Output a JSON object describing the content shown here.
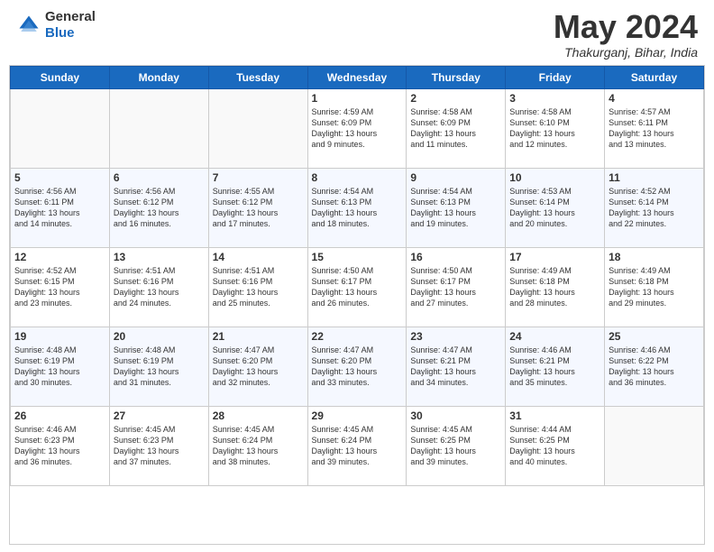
{
  "header": {
    "logo_line1": "General",
    "logo_line2": "Blue",
    "month_title": "May 2024",
    "location": "Thakurganj, Bihar, India"
  },
  "days_of_week": [
    "Sunday",
    "Monday",
    "Tuesday",
    "Wednesday",
    "Thursday",
    "Friday",
    "Saturday"
  ],
  "weeks": [
    [
      {
        "day": "",
        "info": ""
      },
      {
        "day": "",
        "info": ""
      },
      {
        "day": "",
        "info": ""
      },
      {
        "day": "1",
        "info": "Sunrise: 4:59 AM\nSunset: 6:09 PM\nDaylight: 13 hours\nand 9 minutes."
      },
      {
        "day": "2",
        "info": "Sunrise: 4:58 AM\nSunset: 6:09 PM\nDaylight: 13 hours\nand 11 minutes."
      },
      {
        "day": "3",
        "info": "Sunrise: 4:58 AM\nSunset: 6:10 PM\nDaylight: 13 hours\nand 12 minutes."
      },
      {
        "day": "4",
        "info": "Sunrise: 4:57 AM\nSunset: 6:11 PM\nDaylight: 13 hours\nand 13 minutes."
      }
    ],
    [
      {
        "day": "5",
        "info": "Sunrise: 4:56 AM\nSunset: 6:11 PM\nDaylight: 13 hours\nand 14 minutes."
      },
      {
        "day": "6",
        "info": "Sunrise: 4:56 AM\nSunset: 6:12 PM\nDaylight: 13 hours\nand 16 minutes."
      },
      {
        "day": "7",
        "info": "Sunrise: 4:55 AM\nSunset: 6:12 PM\nDaylight: 13 hours\nand 17 minutes."
      },
      {
        "day": "8",
        "info": "Sunrise: 4:54 AM\nSunset: 6:13 PM\nDaylight: 13 hours\nand 18 minutes."
      },
      {
        "day": "9",
        "info": "Sunrise: 4:54 AM\nSunset: 6:13 PM\nDaylight: 13 hours\nand 19 minutes."
      },
      {
        "day": "10",
        "info": "Sunrise: 4:53 AM\nSunset: 6:14 PM\nDaylight: 13 hours\nand 20 minutes."
      },
      {
        "day": "11",
        "info": "Sunrise: 4:52 AM\nSunset: 6:14 PM\nDaylight: 13 hours\nand 22 minutes."
      }
    ],
    [
      {
        "day": "12",
        "info": "Sunrise: 4:52 AM\nSunset: 6:15 PM\nDaylight: 13 hours\nand 23 minutes."
      },
      {
        "day": "13",
        "info": "Sunrise: 4:51 AM\nSunset: 6:16 PM\nDaylight: 13 hours\nand 24 minutes."
      },
      {
        "day": "14",
        "info": "Sunrise: 4:51 AM\nSunset: 6:16 PM\nDaylight: 13 hours\nand 25 minutes."
      },
      {
        "day": "15",
        "info": "Sunrise: 4:50 AM\nSunset: 6:17 PM\nDaylight: 13 hours\nand 26 minutes."
      },
      {
        "day": "16",
        "info": "Sunrise: 4:50 AM\nSunset: 6:17 PM\nDaylight: 13 hours\nand 27 minutes."
      },
      {
        "day": "17",
        "info": "Sunrise: 4:49 AM\nSunset: 6:18 PM\nDaylight: 13 hours\nand 28 minutes."
      },
      {
        "day": "18",
        "info": "Sunrise: 4:49 AM\nSunset: 6:18 PM\nDaylight: 13 hours\nand 29 minutes."
      }
    ],
    [
      {
        "day": "19",
        "info": "Sunrise: 4:48 AM\nSunset: 6:19 PM\nDaylight: 13 hours\nand 30 minutes."
      },
      {
        "day": "20",
        "info": "Sunrise: 4:48 AM\nSunset: 6:19 PM\nDaylight: 13 hours\nand 31 minutes."
      },
      {
        "day": "21",
        "info": "Sunrise: 4:47 AM\nSunset: 6:20 PM\nDaylight: 13 hours\nand 32 minutes."
      },
      {
        "day": "22",
        "info": "Sunrise: 4:47 AM\nSunset: 6:20 PM\nDaylight: 13 hours\nand 33 minutes."
      },
      {
        "day": "23",
        "info": "Sunrise: 4:47 AM\nSunset: 6:21 PM\nDaylight: 13 hours\nand 34 minutes."
      },
      {
        "day": "24",
        "info": "Sunrise: 4:46 AM\nSunset: 6:21 PM\nDaylight: 13 hours\nand 35 minutes."
      },
      {
        "day": "25",
        "info": "Sunrise: 4:46 AM\nSunset: 6:22 PM\nDaylight: 13 hours\nand 36 minutes."
      }
    ],
    [
      {
        "day": "26",
        "info": "Sunrise: 4:46 AM\nSunset: 6:23 PM\nDaylight: 13 hours\nand 36 minutes."
      },
      {
        "day": "27",
        "info": "Sunrise: 4:45 AM\nSunset: 6:23 PM\nDaylight: 13 hours\nand 37 minutes."
      },
      {
        "day": "28",
        "info": "Sunrise: 4:45 AM\nSunset: 6:24 PM\nDaylight: 13 hours\nand 38 minutes."
      },
      {
        "day": "29",
        "info": "Sunrise: 4:45 AM\nSunset: 6:24 PM\nDaylight: 13 hours\nand 39 minutes."
      },
      {
        "day": "30",
        "info": "Sunrise: 4:45 AM\nSunset: 6:25 PM\nDaylight: 13 hours\nand 39 minutes."
      },
      {
        "day": "31",
        "info": "Sunrise: 4:44 AM\nSunset: 6:25 PM\nDaylight: 13 hours\nand 40 minutes."
      },
      {
        "day": "",
        "info": ""
      }
    ]
  ]
}
